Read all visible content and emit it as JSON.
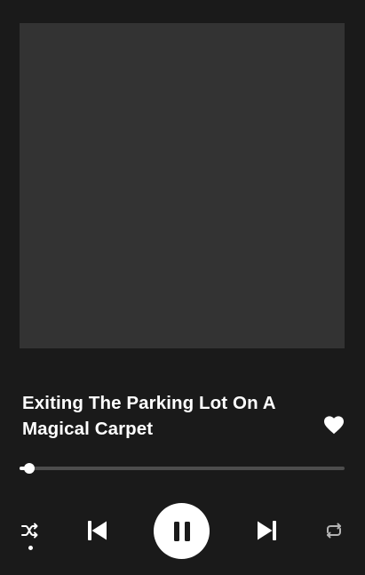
{
  "track": {
    "title": "Exiting The Parking Lot On A Magical Carpet",
    "liked": true
  },
  "playback": {
    "progress": 0.02,
    "is_playing": true,
    "shuffle_enabled": true,
    "repeat_enabled": false
  },
  "icons": {
    "like": "heart-icon",
    "shuffle": "shuffle-icon",
    "previous": "skip-previous-icon",
    "play_pause": "pause-icon",
    "next": "skip-next-icon",
    "repeat": "repeat-icon"
  },
  "colors": {
    "background": "#1a1a1a",
    "artwork_placeholder": "#333333",
    "accent": "#ffffff",
    "track_inactive": "#4d4d4d",
    "icon_inactive": "#b3b3b3"
  }
}
